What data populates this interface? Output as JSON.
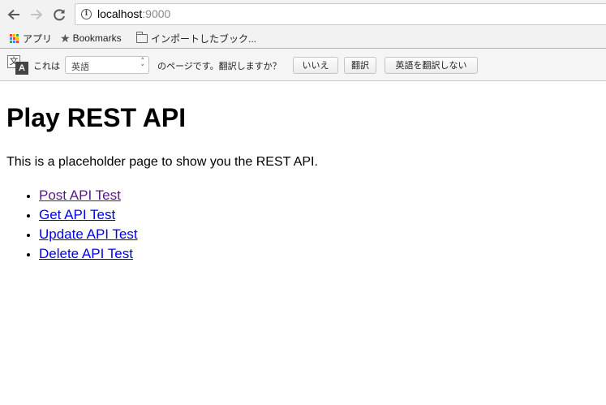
{
  "browser": {
    "url_host": "localhost",
    "url_port": ":9000"
  },
  "bookmarks_bar": {
    "items": [
      {
        "label": "アプリ",
        "icon": "apps-grid-icon"
      },
      {
        "label": "Bookmarks",
        "icon": "star-icon"
      },
      {
        "label": "インポートしたブック...",
        "icon": "folder-icon"
      }
    ]
  },
  "translate_bar": {
    "prefix": "これは",
    "language": "英語",
    "suffix": "のページです。翻訳しますか？",
    "buttons": [
      "いいえ",
      "翻訳",
      "英語を翻訳しない"
    ]
  },
  "page": {
    "title": "Play REST API",
    "intro": "This is a placeholder page to show you the REST API.",
    "links": [
      {
        "label": "Post API Test",
        "visited": true
      },
      {
        "label": "Get API Test",
        "visited": false
      },
      {
        "label": "Update API Test",
        "visited": false
      },
      {
        "label": "Delete API Test",
        "visited": false
      }
    ]
  },
  "colors": {
    "link": "#0000ee",
    "visited_link": "#551a8b"
  }
}
